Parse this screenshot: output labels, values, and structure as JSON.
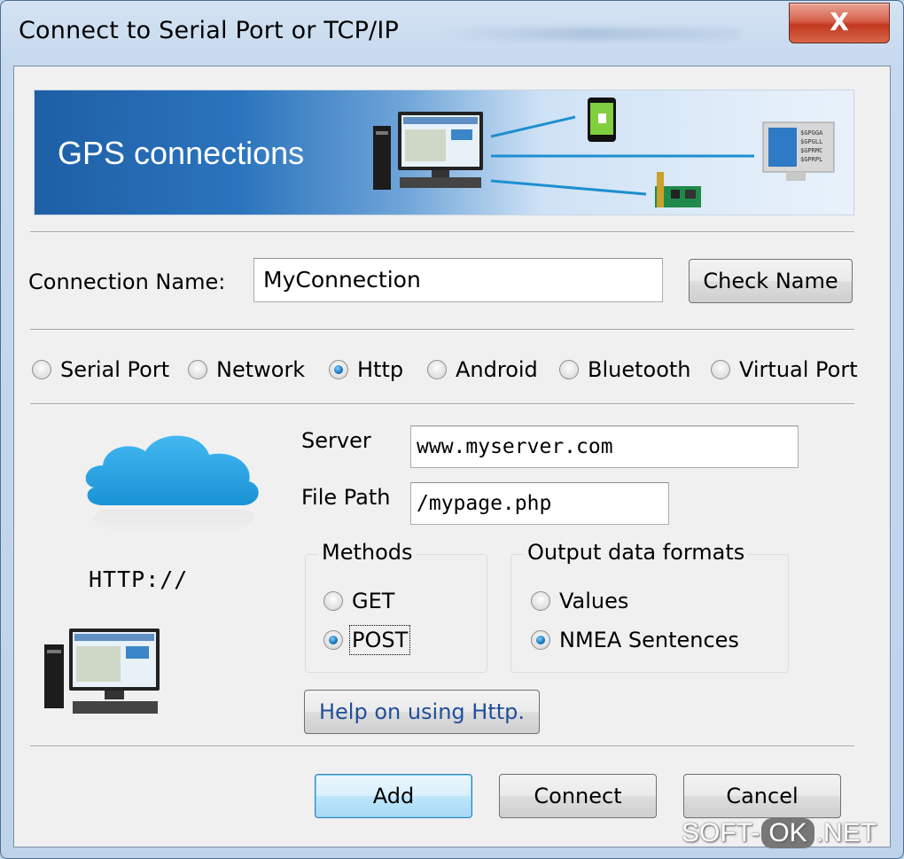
{
  "window": {
    "title": "Connect to Serial Port or TCP/IP",
    "close_label": "X"
  },
  "banner": {
    "title": "GPS connections",
    "monitor_lines": [
      "$GPGGA",
      "$GPGLL",
      "$GPRMC",
      "$GPRPL"
    ]
  },
  "connection": {
    "name_label": "Connection Name:",
    "name_value": "MyConnection",
    "check_name_label": "Check Name"
  },
  "connection_types": [
    {
      "label": "Serial Port",
      "selected": false
    },
    {
      "label": "Network",
      "selected": false
    },
    {
      "label": "Http",
      "selected": true
    },
    {
      "label": "Android",
      "selected": false
    },
    {
      "label": "Bluetooth",
      "selected": false
    },
    {
      "label": "Virtual Port",
      "selected": false
    }
  ],
  "http": {
    "illustration_label": "HTTP://",
    "server_label": "Server",
    "server_value": "www.myserver.com",
    "file_path_label": "File Path",
    "file_path_value": "/mypage.php",
    "methods": {
      "title": "Methods",
      "options": [
        {
          "label": "GET",
          "selected": false
        },
        {
          "label": "POST",
          "selected": true
        }
      ]
    },
    "output_formats": {
      "title": "Output data formats",
      "options": [
        {
          "label": "Values",
          "selected": false
        },
        {
          "label": "NMEA Sentences",
          "selected": true
        }
      ]
    },
    "help_label": "Help on using Http."
  },
  "footer": {
    "add_label": "Add",
    "connect_label": "Connect",
    "cancel_label": "Cancel"
  },
  "watermark": {
    "left": "SOFT-",
    "middle": "OK",
    "right": ".NET"
  },
  "colors": {
    "banner_dark": "#1e5fa6",
    "cloud": "#29a8e6",
    "help_link": "#1f4f9a"
  }
}
